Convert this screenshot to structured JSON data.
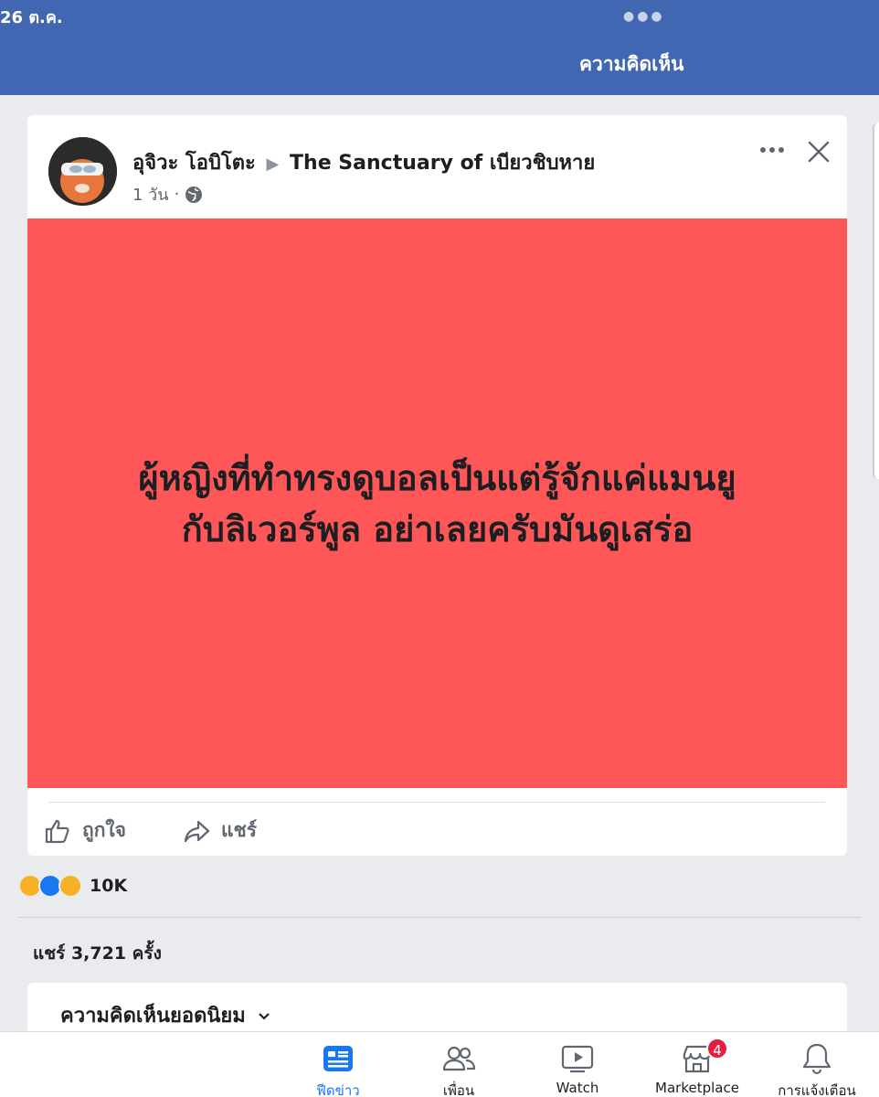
{
  "status_bar": {
    "time": "26 ต.ค."
  },
  "header": {
    "title": "ความคิดเห็น"
  },
  "post": {
    "author": "อุจิวะ โอบิโตะ",
    "group": "The Sanctuary of เบียวชิบหาย",
    "time": "1 วัน",
    "text_line1": "ผู้หญิงที่ทำทรงดูบอลเป็นแต่รู้จักแค่แมนยู",
    "text_line2": "กับลิเวอร์พูล อย่าเลยครับมันดูเสร่อ",
    "background_color": "#ff5757"
  },
  "actions": {
    "like_label": "ถูกใจ",
    "share_label": "แชร์"
  },
  "reactions": {
    "icons": [
      "haha-icon",
      "like-icon",
      "sad-icon"
    ],
    "count": "10K"
  },
  "shares": {
    "text": "แชร์ 3,721 ครั้ง"
  },
  "comments": {
    "sort_label": "ความคิดเห็นยอดนิยม"
  },
  "tabs": [
    {
      "label": "ฟีดข่าว",
      "icon": "news-feed-icon",
      "active": true
    },
    {
      "label": "เพื่อน",
      "icon": "friends-icon"
    },
    {
      "label": "Watch",
      "icon": "watch-icon"
    },
    {
      "label": "Marketplace",
      "icon": "marketplace-icon",
      "badge": "4"
    },
    {
      "label": "การแจ้งเตือน",
      "icon": "bell-icon"
    }
  ],
  "colors": {
    "header": "#4267b2",
    "accent": "#1877f2",
    "badge": "#e41e3f"
  }
}
